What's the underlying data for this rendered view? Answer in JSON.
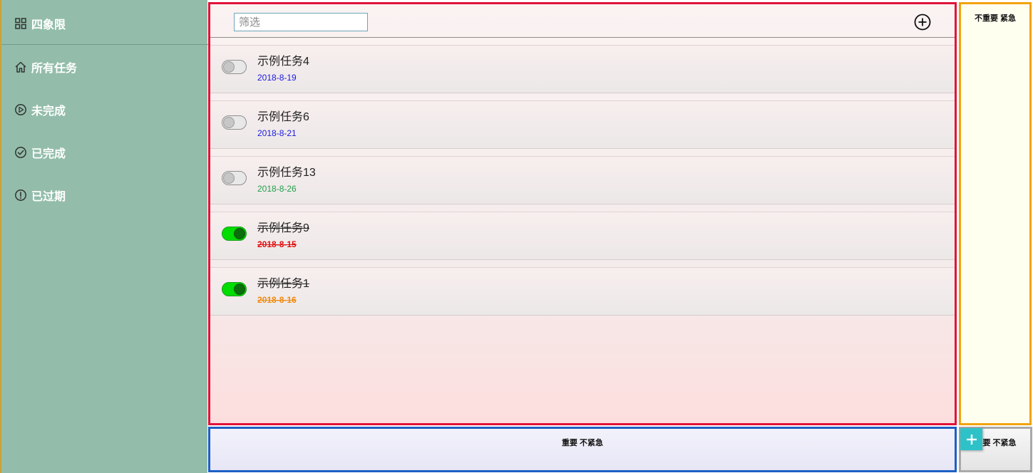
{
  "sidebar": {
    "items": [
      {
        "label": "四象限",
        "icon": "grid-icon"
      },
      {
        "label": "所有任务",
        "icon": "home-icon"
      },
      {
        "label": "未完成",
        "icon": "play-circle-icon"
      },
      {
        "label": "已完成",
        "icon": "check-circle-icon"
      },
      {
        "label": "已过期",
        "icon": "alert-circle-icon"
      }
    ]
  },
  "main": {
    "filter_placeholder": "筛选",
    "filter_value": "",
    "add_icon": "plus-circle-icon",
    "tasks": [
      {
        "title": "示例任务4",
        "date": "2018-8-19",
        "date_color": "#1a1add",
        "done": false
      },
      {
        "title": "示例任务6",
        "date": "2018-8-21",
        "date_color": "#1a1add",
        "done": false
      },
      {
        "title": "示例任务13",
        "date": "2018-8-26",
        "date_color": "#1f9e4a",
        "done": false
      },
      {
        "title": "示例任务9",
        "date": "2018-8-15",
        "date_color": "#e01010",
        "done": true
      },
      {
        "title": "示例任务1",
        "date": "2018-8-16",
        "date_color": "#f08a10",
        "done": true
      }
    ]
  },
  "quadrants": {
    "top_right": "不重要 紧急",
    "bottom_left": "重要 不紧急",
    "bottom_right": "重要 不紧急"
  },
  "colors": {
    "sidebar_bg": "#93bdaa",
    "main_border": "#e0123a",
    "right_border": "#f2a30c",
    "bottom_left_border": "#1c5fc4",
    "fab_bg": "#2ec2c8",
    "toggle_on": "#00dd00"
  }
}
